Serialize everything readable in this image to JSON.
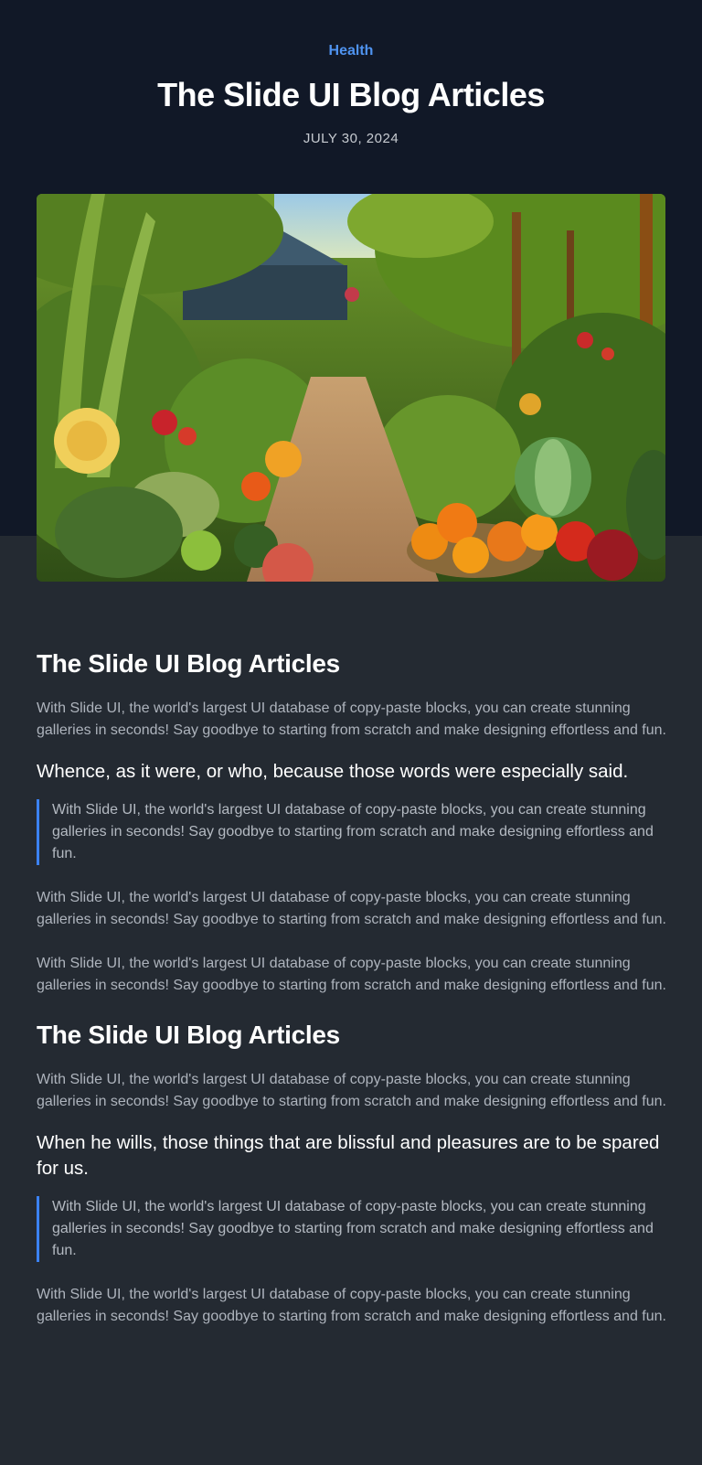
{
  "hero": {
    "category": "Health",
    "title": "The Slide UI Blog Articles",
    "date": "JULY 30, 2024"
  },
  "hero_image": {
    "icon": "garden-illustration"
  },
  "article": {
    "section1": {
      "heading": "The Slide UI Blog Articles",
      "paragraph1": "With Slide UI, the world's largest UI database of copy-paste blocks, you can create stunning galleries in seconds! Say goodbye to starting from scratch and make designing effortless and fun.",
      "subheading": "Whence, as it were, or who, because those words were especially said.",
      "quote": "With Slide UI, the world's largest UI database of copy-paste blocks, you can create stunning galleries in seconds! Say goodbye to starting from scratch and make designing effortless and fun.",
      "paragraph2": "With Slide UI, the world's largest UI database of copy-paste blocks, you can create stunning galleries in seconds! Say goodbye to starting from scratch and make designing effortless and fun.",
      "paragraph3": "With Slide UI, the world's largest UI database of copy-paste blocks, you can create stunning galleries in seconds! Say goodbye to starting from scratch and make designing effortless and fun."
    },
    "section2": {
      "heading": "The Slide UI Blog Articles",
      "paragraph1": "With Slide UI, the world's largest UI database of copy-paste blocks, you can create stunning galleries in seconds! Say goodbye to starting from scratch and make designing effortless and fun.",
      "subheading": "When he wills, those things that are blissful and pleasures are to be spared for us.",
      "quote": "With Slide UI, the world's largest UI database of copy-paste blocks, you can create stunning galleries in seconds! Say goodbye to starting from scratch and make designing effortless and fun.",
      "paragraph2": "With Slide UI, the world's largest UI database of copy-paste blocks, you can create stunning galleries in seconds! Say goodbye to starting from scratch and make designing effortless and fun."
    }
  },
  "colors": {
    "hero_bg": "#111827",
    "content_bg": "#242a32",
    "accent": "#4f93f0",
    "quote_border": "#3b82f6",
    "body_text": "#aeb4bd"
  }
}
